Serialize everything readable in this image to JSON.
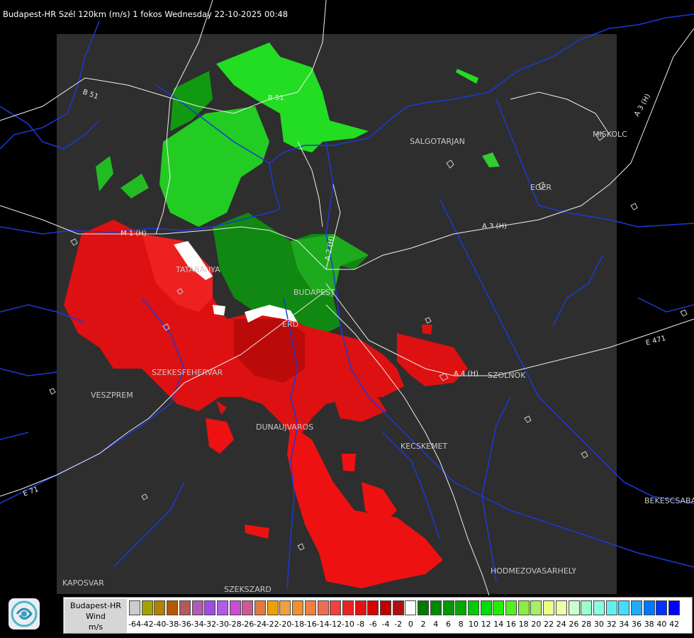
{
  "header": {
    "title": "Budapest-HR Szél 120km (m/s) 1 fokos Wednesday 22-10-2025 00:48"
  },
  "map": {
    "cities": [
      "SALGOTARJAN",
      "MISKOLC",
      "EGER",
      "TATABANYA",
      "BUDAPEST",
      "ERD",
      "SZEKESFEHERVAR",
      "VESZPREM",
      "SZOLNOK",
      "DUNAUJVAROS",
      "KECSKEMET",
      "BEKESCSABA",
      "KAPOSVAR",
      "SZEKSZARD",
      "HODMEZOVASARHELY"
    ],
    "roads": [
      "B 51",
      "B 51",
      "A 3 (H)",
      "A 3 (H)",
      "E 71",
      "E 471",
      "A 4 (H)",
      "A 2 (H)",
      "M 1 (H)"
    ],
    "colors": {
      "approaching": "#ee1111",
      "receding": "#22bb22",
      "background": "#2e2e2e",
      "outside": "#000000",
      "borders": "#1a3ad8",
      "roads": "#ffffff"
    }
  },
  "legend": {
    "station_line1": "Budapest-HR",
    "station_line2": "Wind",
    "station_line3": "m/s",
    "tick_labels": [
      "-64",
      "-42",
      "-40",
      "-38",
      "-36",
      "-34",
      "-32",
      "-30",
      "-28",
      "-26",
      "-24",
      "-22",
      "-20",
      "-18",
      "-16",
      "-14",
      "-12",
      "-10",
      "-8",
      "-6",
      "-4",
      "-2",
      "0",
      "2",
      "4",
      "6",
      "8",
      "10",
      "12",
      "14",
      "16",
      "18",
      "20",
      "22",
      "24",
      "26",
      "28",
      "30",
      "32",
      "34",
      "36",
      "38",
      "40",
      "42"
    ],
    "colors": [
      "#cccccc",
      "#a3a300",
      "#b38000",
      "#b35a00",
      "#b35a5a",
      "#b35ab3",
      "#9b4de6",
      "#b35ae6",
      "#c84dd2",
      "#cc5a99",
      "#e07a40",
      "#f0a000",
      "#f0a040",
      "#f09030",
      "#f08040",
      "#e87050",
      "#f04040",
      "#f02020",
      "#e81010",
      "#d80000",
      "#c00000",
      "#b01010",
      "#ffffff",
      "#007a00",
      "#008800",
      "#009900",
      "#00aa00",
      "#00cc00",
      "#00dd00",
      "#22ee00",
      "#55ee22",
      "#88ee44",
      "#aaee66",
      "#eeff88",
      "#eeffaa",
      "#ccffcc",
      "#99ffcc",
      "#88ffdd",
      "#66eeee",
      "#44ddff",
      "#22aaff",
      "#0077ff",
      "#0033ff",
      "#0000ff"
    ]
  }
}
